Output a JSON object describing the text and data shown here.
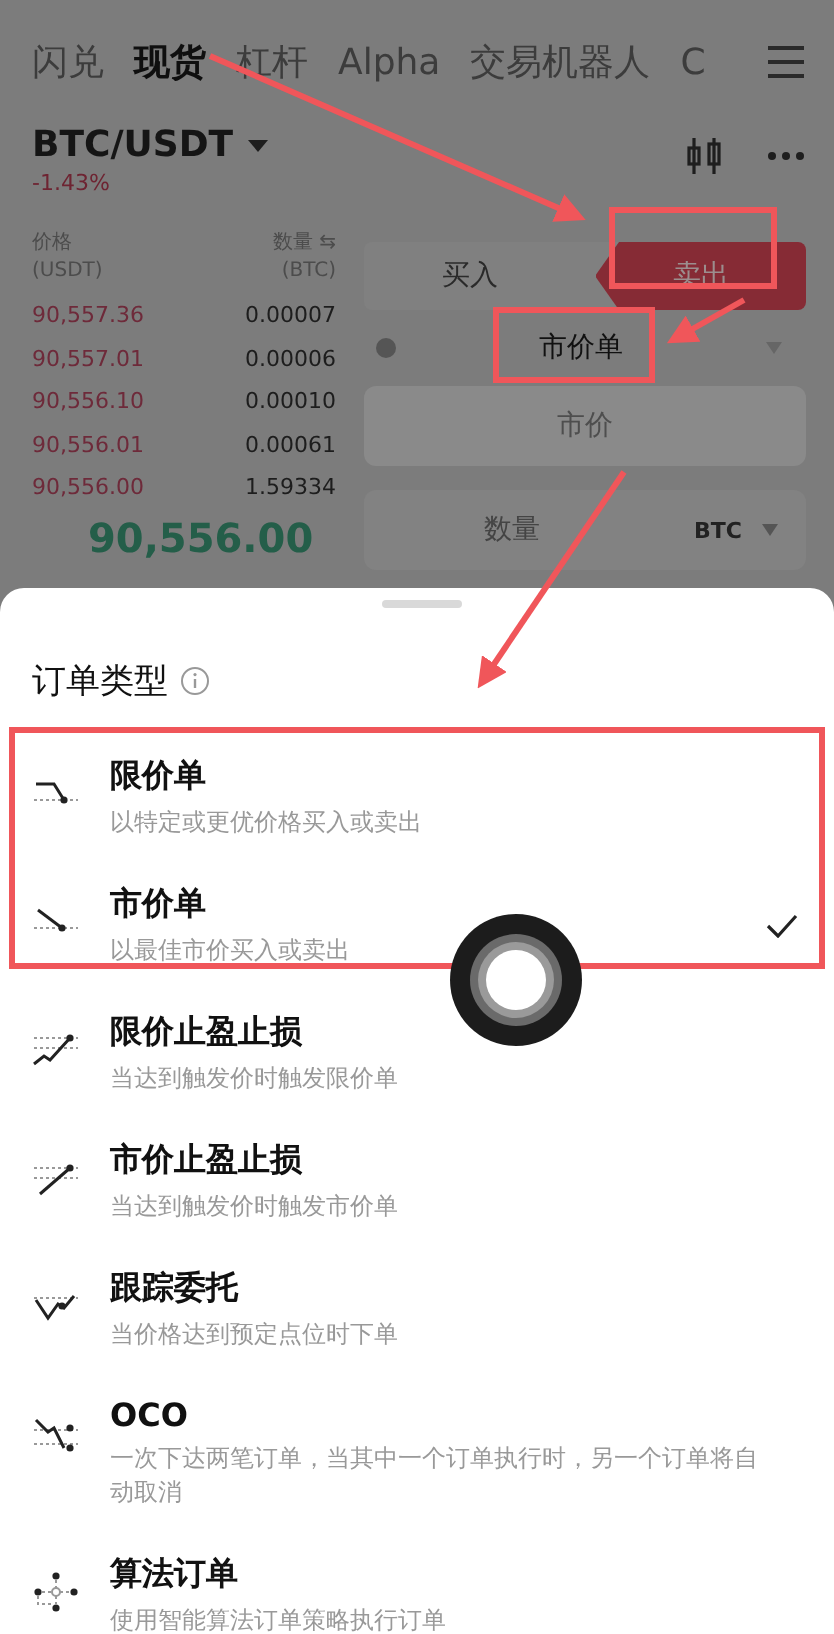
{
  "tabs": [
    {
      "label": "闪兑",
      "selected": false
    },
    {
      "label": "现货",
      "selected": true
    },
    {
      "label": "杠杆",
      "selected": false
    },
    {
      "label": "Alpha",
      "selected": false
    },
    {
      "label": "交易机器人",
      "selected": false
    },
    {
      "label": "C",
      "selected": false
    }
  ],
  "pair": {
    "symbol": "BTC/USDT",
    "change": "-1.43%"
  },
  "order_book": {
    "columns": [
      {
        "label": "价格",
        "unit": "(USDT)"
      },
      {
        "label": "数量 ⇆",
        "unit": "(BTC)"
      }
    ],
    "asks": [
      {
        "price": "90,557.36",
        "amount": "0.00007"
      },
      {
        "price": "90,557.01",
        "amount": "0.00006"
      },
      {
        "price": "90,556.10",
        "amount": "0.00010"
      },
      {
        "price": "90,556.01",
        "amount": "0.00061"
      },
      {
        "price": "90,556.00",
        "amount": "1.59334"
      }
    ],
    "last_price": "90,556.00"
  },
  "side_toggle": [
    {
      "label": "买入",
      "selected": false
    },
    {
      "label": "卖出",
      "selected": true
    }
  ],
  "order_type_select": {
    "value": "市价单"
  },
  "price_field": {
    "value": "市价",
    "disabled": true
  },
  "amount_field": {
    "placeholder": "数量",
    "unit": "BTC"
  },
  "sheet": {
    "title": "订单类型",
    "order_types": [
      {
        "kind": "limit",
        "title": "限价单",
        "description": "以特定或更优价格买入或卖出",
        "selected": false
      },
      {
        "kind": "market",
        "title": "市价单",
        "description": "以最佳市价买入或卖出",
        "selected": true
      },
      {
        "kind": "limit-tpsl",
        "title": "限价止盈止损",
        "description": "当达到触发价时触发限价单",
        "selected": false
      },
      {
        "kind": "market-tpsl",
        "title": "市价止盈止损",
        "description": "当达到触发价时触发市价单",
        "selected": false
      },
      {
        "kind": "trailing",
        "title": "跟踪委托",
        "description": "当价格达到预定点位时下单",
        "selected": false
      },
      {
        "kind": "oco",
        "title": "OCO",
        "description": "一次下达两笔订单，当其中一个订单执行时，另一个订单将自动取消",
        "selected": false
      },
      {
        "kind": "algo",
        "title": "算法订单",
        "description": "使用智能算法订单策略执行订单",
        "selected": false
      }
    ]
  }
}
